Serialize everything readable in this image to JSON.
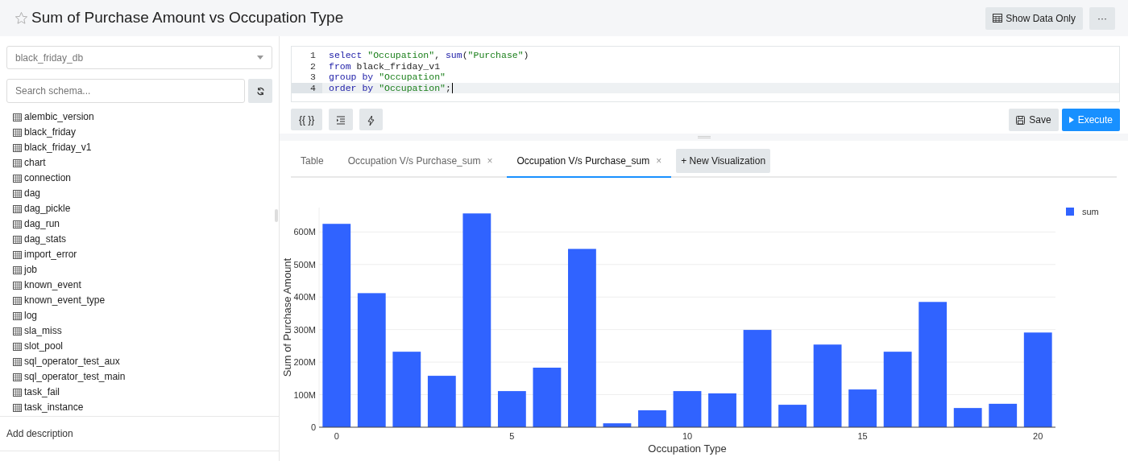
{
  "header": {
    "title": "Sum of Purchase Amount vs Occupation Type",
    "starred": false,
    "buttons": [
      {
        "label": "Show Data Only",
        "kind": "table"
      },
      {
        "label": "···",
        "kind": "more"
      }
    ]
  },
  "sidebar": {
    "database": "black_friday_db",
    "search": {
      "placeholder": "Search schema..."
    },
    "tables": [
      "alembic_version",
      "black_friday",
      "black_friday_v1",
      "chart",
      "connection",
      "dag",
      "dag_pickle",
      "dag_run",
      "dag_stats",
      "import_error",
      "job",
      "known_event",
      "known_event_type",
      "log",
      "sla_miss",
      "slot_pool",
      "sql_operator_test_aux",
      "sql_operator_test_main",
      "task_fail",
      "task_instance"
    ],
    "footer": "Add description"
  },
  "editor": {
    "lines": [
      {
        "number": "1",
        "active": false,
        "tokens": [
          {
            "text": "select ",
            "kind": "keyword"
          },
          {
            "text": "\"Occupation\"",
            "kind": "string"
          },
          {
            "text": ", ",
            "kind": "plain"
          },
          {
            "text": "sum",
            "kind": "keyword"
          },
          {
            "text": "(",
            "kind": "plain"
          },
          {
            "text": "\"Purchase\"",
            "kind": "string"
          },
          {
            "text": ")",
            "kind": "plain"
          }
        ]
      },
      {
        "number": "2",
        "active": false,
        "tokens": [
          {
            "text": "from",
            "kind": "keyword"
          },
          {
            "text": " black_friday_v1",
            "kind": "plain"
          }
        ]
      },
      {
        "number": "3",
        "active": false,
        "tokens": [
          {
            "text": "group by ",
            "kind": "keyword"
          },
          {
            "text": "\"Occupation\"",
            "kind": "string"
          }
        ]
      },
      {
        "number": "4",
        "active": true,
        "tokens": [
          {
            "text": "order by ",
            "kind": "keyword"
          },
          {
            "text": "\"Occupation\"",
            "kind": "string"
          },
          {
            "text": ";",
            "kind": "plain"
          }
        ]
      }
    ]
  },
  "toolbar": {
    "tools": [
      {
        "kind": "text",
        "label": "{{ }}"
      },
      {
        "kind": "indent"
      },
      {
        "kind": "bolt"
      }
    ],
    "actions": [
      {
        "kind": "save",
        "label": "Save"
      },
      {
        "kind": "execute",
        "label": "Execute"
      }
    ]
  },
  "tabs": [
    {
      "label": "Table",
      "selected": false
    },
    {
      "label": "Occupation V/s Purchase_sum",
      "close": "×",
      "selected": false
    },
    {
      "label": "Occupation V/s Purchase_sum",
      "close": "×",
      "selected": true
    }
  ],
  "new_visualization": "+ New Visualization",
  "chart_data": {
    "type": "bar",
    "xlabel": "Occupation Type",
    "ylabel": "Sum of Purchase Amount",
    "x": [
      0,
      1,
      2,
      3,
      4,
      5,
      6,
      7,
      8,
      9,
      10,
      11,
      12,
      13,
      14,
      15,
      16,
      17,
      18,
      19,
      20
    ],
    "grid": true,
    "series": [
      {
        "name": "sum",
        "color": "#3063ff",
        "values": [
          625000000,
          412000000,
          232000000,
          158000000,
          657000000,
          111000000,
          183000000,
          548000000,
          12000000,
          52000000,
          111000000,
          104000000,
          299000000,
          69000000,
          254000000,
          116000000,
          232000000,
          385000000,
          59000000,
          72000000,
          291000000
        ]
      }
    ],
    "xlim": [
      -0.5,
      20.5
    ],
    "ylim": [
      0,
      675000000
    ],
    "xticks": [
      0,
      5,
      10,
      15,
      20
    ],
    "yticks": [
      {
        "value": 0,
        "label": "0"
      },
      {
        "value": 100000000,
        "label": "100M"
      },
      {
        "value": 200000000,
        "label": "200M"
      },
      {
        "value": 300000000,
        "label": "300M"
      },
      {
        "value": 400000000,
        "label": "400M"
      },
      {
        "value": 500000000,
        "label": "500M"
      },
      {
        "value": 600000000,
        "label": "600M"
      }
    ]
  }
}
